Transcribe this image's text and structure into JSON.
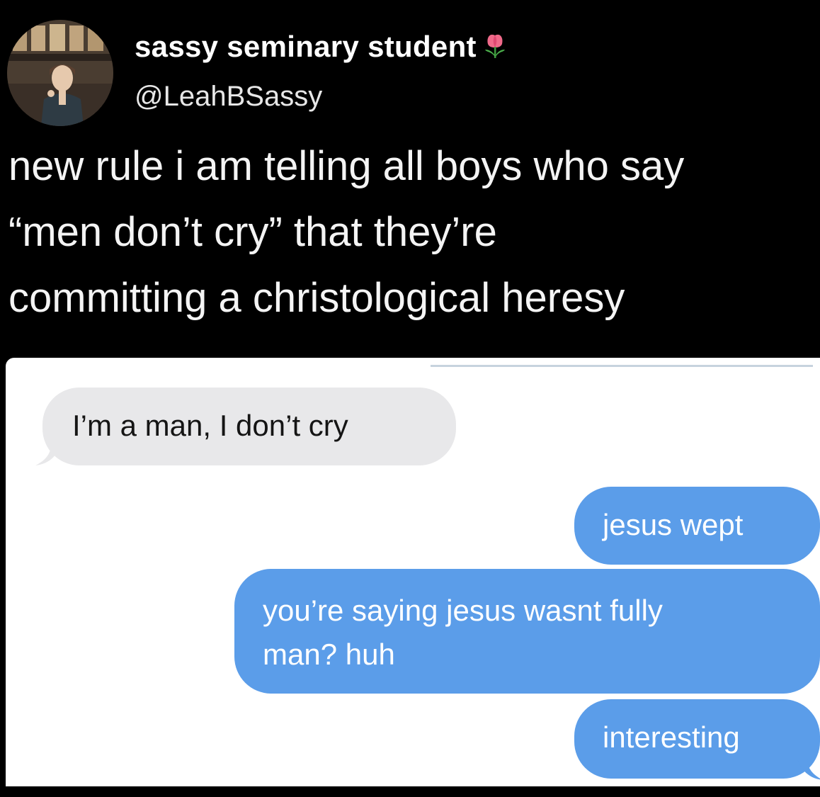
{
  "tweet": {
    "display_name": "sassy seminary student",
    "name_emoji_icon": "tulip-icon",
    "handle": "@LeahBSassy",
    "text": "new rule i am telling all boys who say\n“men don’t cry” that they’re\ncommitting a christological heresy"
  },
  "conversation": {
    "messages": [
      {
        "direction": "received",
        "text": "I’m a man, I don’t cry"
      },
      {
        "direction": "sent",
        "text": "jesus wept"
      },
      {
        "direction": "sent",
        "text": "you’re saying jesus wasnt fully\nman? huh"
      },
      {
        "direction": "sent",
        "text": "interesting"
      }
    ]
  },
  "colors": {
    "background": "#000000",
    "sent_bubble": "#5b9de9",
    "received_bubble": "#e8e8ea"
  }
}
